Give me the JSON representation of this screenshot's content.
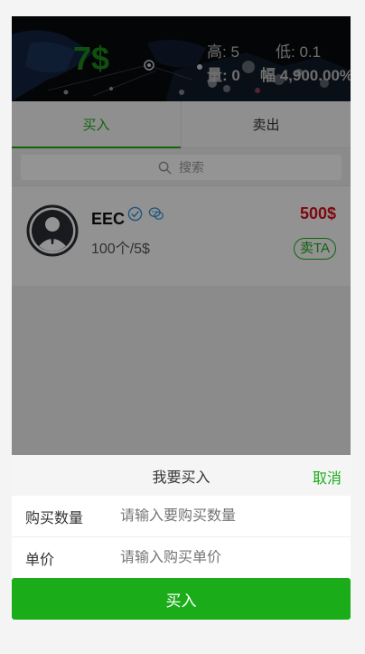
{
  "header": {
    "price": "7$",
    "high": "高: 5",
    "low": "低: 0.1",
    "volume": "量: 0",
    "change": "幅 4,900.00%"
  },
  "tabs": [
    {
      "label": "买入",
      "active": true
    },
    {
      "label": "卖出",
      "active": false
    }
  ],
  "search": {
    "placeholder": "搜索"
  },
  "listing": {
    "name": "EEC",
    "quantity": "100个/5$",
    "amount": "500$",
    "action_label": "卖TA",
    "icons": [
      "verified-icon",
      "wechat-icon"
    ]
  },
  "sheet": {
    "title": "我要买入",
    "cancel_label": "取消",
    "fields": [
      {
        "label": "购买数量",
        "placeholder": "请输入要购买数量"
      },
      {
        "label": "单价",
        "placeholder": "请输入购买单价"
      }
    ],
    "submit_label": "买入"
  },
  "colors": {
    "accent": "#1aad19",
    "price_green": "#1a8a1a",
    "amount_red": "#d80f1c"
  }
}
